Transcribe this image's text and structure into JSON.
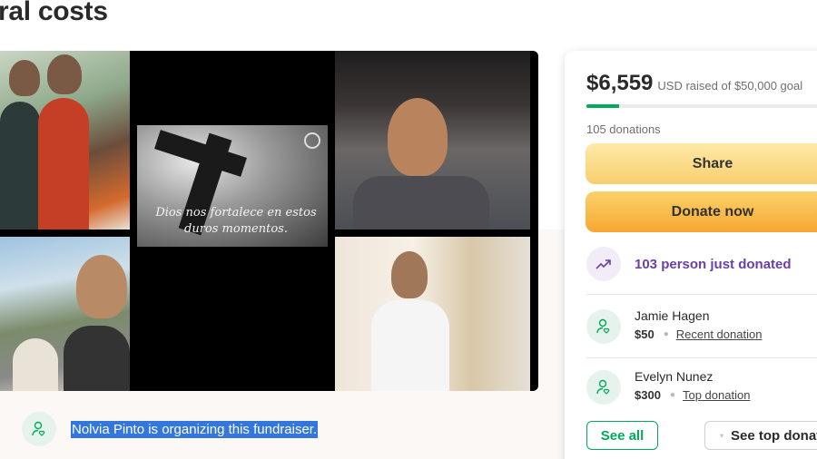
{
  "page": {
    "title": "ral costs"
  },
  "collage": {
    "caption": "Dios nos fortalece en estos duros momentos."
  },
  "organizer": {
    "text": "Nolvia Pinto is organizing this fundraiser."
  },
  "card": {
    "raised_amount": "$6,559",
    "raised_text": "USD raised of $50,000 goal",
    "progress_fraction": 0.131,
    "donation_count": "105 donations",
    "share_label": "Share",
    "donate_label": "Donate now",
    "just_donated": "103 person just donated",
    "donors": [
      {
        "name": "Jamie Hagen",
        "amount": "$50",
        "tag": "Recent donation"
      },
      {
        "name": "Evelyn Nunez",
        "amount": "$300",
        "tag": "Top donation"
      }
    ],
    "see_all_label": "See all",
    "see_top_label": "See top donations"
  },
  "colors": {
    "accent_green": "#02a95c",
    "purple": "#6a3fa8",
    "donate_orange": "#f7a730"
  }
}
